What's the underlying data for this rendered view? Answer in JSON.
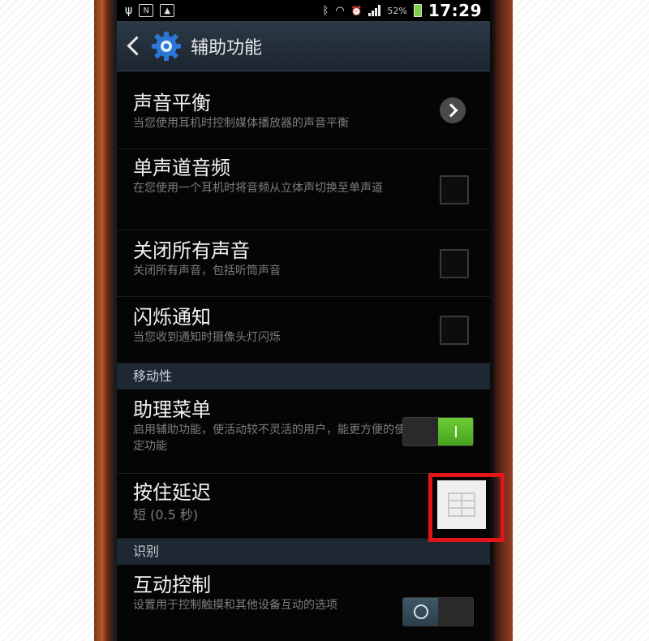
{
  "statusbar": {
    "left_icons": [
      "usb-icon",
      "n-icon",
      "image-icon"
    ],
    "battery": "52%",
    "time": "17:29"
  },
  "titlebar": {
    "title": "辅助功能"
  },
  "list": {
    "rows": [
      {
        "title": "声音平衡",
        "subtitle": "当您使用耳机时控制媒体播放器的声音平衡",
        "control": "chevron"
      },
      {
        "title": "单声道音频",
        "subtitle": "在您使用一个耳机时将音频从立体声切换至单声道",
        "control": "checkbox"
      },
      {
        "title": "关闭所有声音",
        "subtitle": "关闭所有声音，包括听筒声音",
        "control": "checkbox"
      },
      {
        "title": "闪烁通知",
        "subtitle": "当您收到通知时摄像头灯闪烁",
        "control": "checkbox"
      }
    ],
    "section_mobility": "移动性",
    "row_assistant": {
      "title": "助理菜单",
      "subtitle": "启用辅助功能，使活动较不灵活的用户，能更方便的使用特定功能",
      "state": "on"
    },
    "row_hold_delay": {
      "title": "按住延迟",
      "subtitle": "短 (0.5 秒)"
    },
    "section_recognition": "识别",
    "row_interaction": {
      "title": "互动控制",
      "subtitle": "设置用于控制触摸和其他设备互动的选项",
      "state": "off"
    }
  },
  "colors": {
    "toggle_on": "#5bbf2a",
    "highlight": "#e3141a",
    "section_bg": "#1d2833"
  }
}
